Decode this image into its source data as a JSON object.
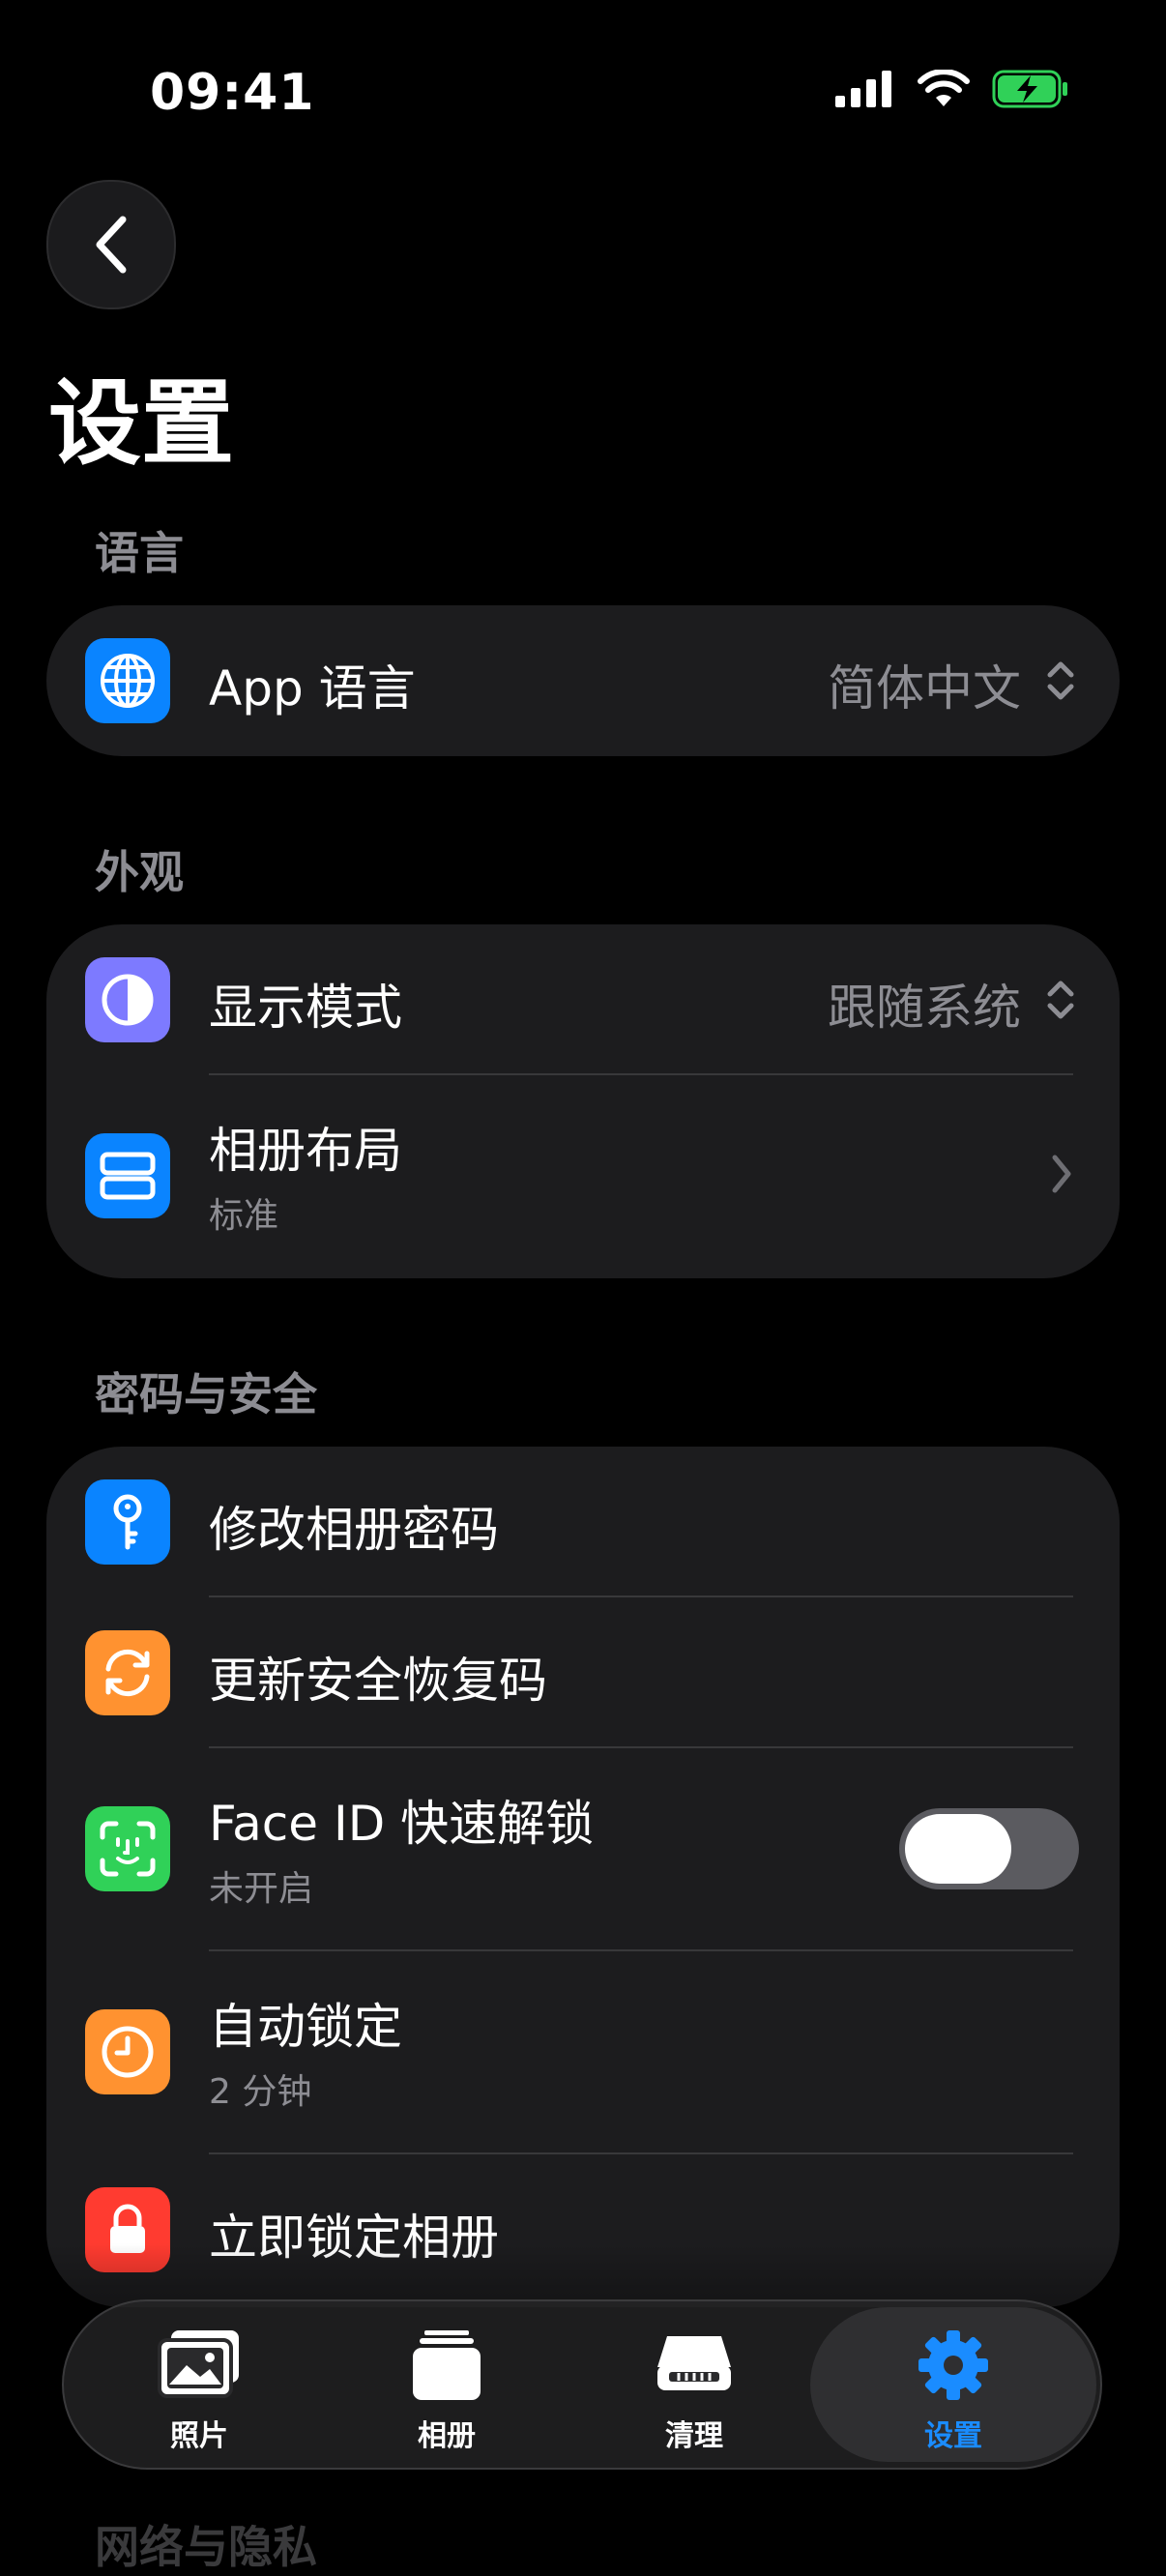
{
  "status_bar": {
    "time": "09:41"
  },
  "page": {
    "title": "设置"
  },
  "sections": {
    "language": {
      "header": "语言",
      "app_language": {
        "title": "App 语言",
        "value": "简体中文"
      }
    },
    "appearance": {
      "header": "外观",
      "display_mode": {
        "title": "显示模式",
        "value": "跟随系统"
      },
      "album_layout": {
        "title": "相册布局",
        "subtitle": "标准"
      }
    },
    "security": {
      "header": "密码与安全",
      "change_password": {
        "title": "修改相册密码"
      },
      "recovery_code": {
        "title": "更新安全恢复码"
      },
      "face_id": {
        "title": "Face ID 快速解锁",
        "subtitle": "未开启",
        "enabled": false
      },
      "auto_lock": {
        "title": "自动锁定",
        "subtitle": "2 分钟"
      },
      "lock_now": {
        "title": "立即锁定相册"
      }
    },
    "next_section_header": "网络与隐私"
  },
  "tab_bar": {
    "tabs": [
      {
        "label": "照片",
        "icon": "photos-icon"
      },
      {
        "label": "相册",
        "icon": "albums-icon"
      },
      {
        "label": "清理",
        "icon": "cleanup-icon"
      },
      {
        "label": "设置",
        "icon": "settings-gear-icon",
        "active": true
      }
    ]
  },
  "colors": {
    "accent": "#1a8cff",
    "globe_icon_bg": "#0a84ff",
    "display_icon_bg": "#7d7aff",
    "layout_icon_bg": "#0a84ff",
    "key_icon_bg": "#0a84ff",
    "recovery_icon_bg": "#ff9230",
    "faceid_icon_bg": "#30d158",
    "clock_icon_bg": "#ff9230",
    "lock_icon_bg": "#ff3b30"
  }
}
